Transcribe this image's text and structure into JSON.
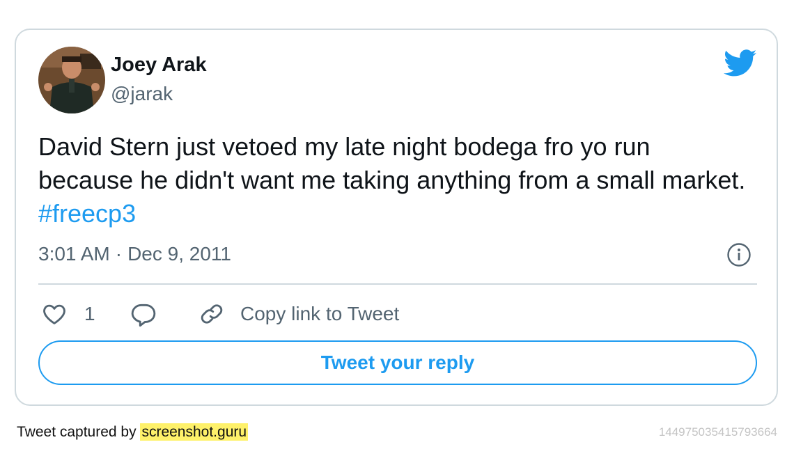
{
  "user": {
    "name": "Joey Arak",
    "handle": "@jarak"
  },
  "tweet": {
    "text": "David Stern just vetoed my late night bodega fro yo run because he didn't want me taking anything from a small market.",
    "hashtag": "#freecp3",
    "time": "3:01 AM",
    "separator": "·",
    "date": "Dec 9, 2011"
  },
  "actions": {
    "like_count": "1",
    "copy_link_label": "Copy link to Tweet",
    "reply_button_label": "Tweet your reply"
  },
  "footer": {
    "captured_by_prefix": "Tweet captured by",
    "captured_by_site": "screenshot.guru",
    "tweet_id": "144975035415793664"
  },
  "colors": {
    "accent": "#1d9bf0",
    "secondary_text": "#536471",
    "border": "#cfd9de",
    "highlight": "#fef16a"
  },
  "icons": [
    "twitter-bird-icon",
    "info-icon",
    "heart-icon",
    "reply-icon",
    "link-icon"
  ]
}
